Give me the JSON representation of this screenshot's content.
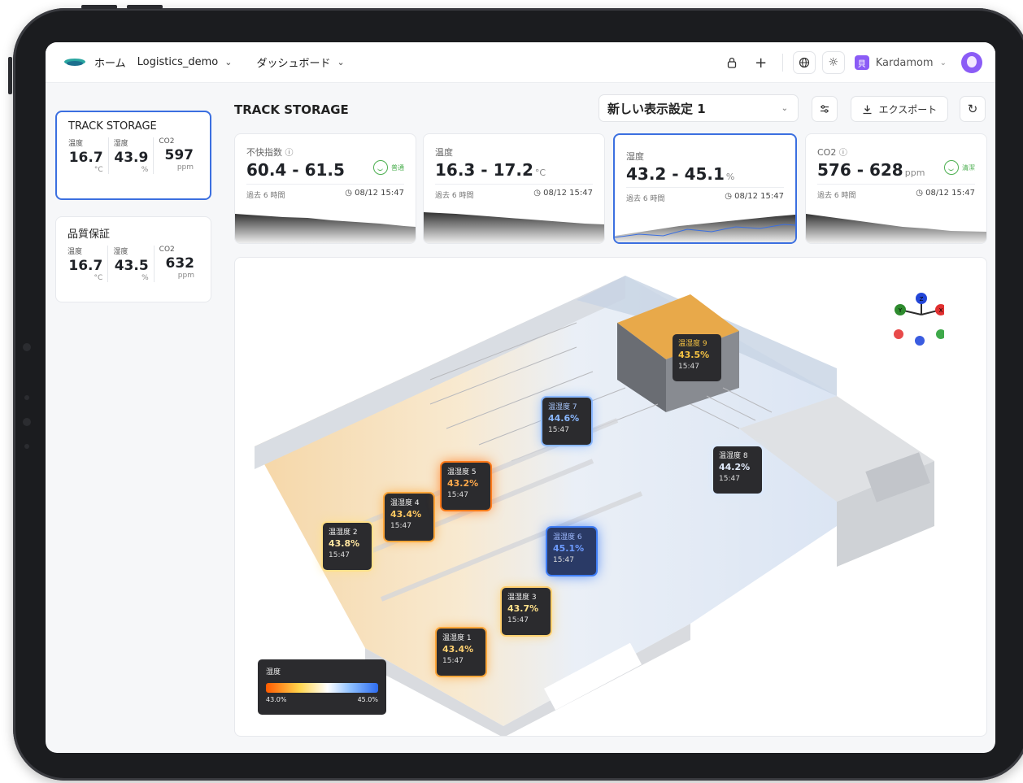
{
  "nav": {
    "home": "ホーム",
    "project": "Logistics_demo",
    "dashboard": "ダッシュボード",
    "user_initial": "貝",
    "user_name": "Kardamom"
  },
  "sidebar": {
    "locations": [
      {
        "name": "TRACK STORAGE",
        "temp_label": "温度",
        "hum_label": "湿度",
        "co2_label": "CO2",
        "temp": "16.7",
        "hum": "43.9",
        "co2": "597",
        "temp_unit": "°C",
        "hum_unit": "%",
        "co2_unit": "ppm"
      },
      {
        "name": "品質保証",
        "temp_label": "温度",
        "hum_label": "湿度",
        "co2_label": "CO2",
        "temp": "16.7",
        "hum": "43.5",
        "co2": "632",
        "temp_unit": "°C",
        "hum_unit": "%",
        "co2_unit": "ppm"
      }
    ]
  },
  "main": {
    "title": "TRACK STORAGE",
    "view_setting": "新しい表示設定 1",
    "export_label": "エクスポート"
  },
  "metrics": [
    {
      "label": "不快指数",
      "value": "60.4 - 61.5",
      "unit": "",
      "status": "普通",
      "period": "過去 6 時間",
      "time": "08/12 15:47"
    },
    {
      "label": "温度",
      "value": "16.3 - 17.2",
      "unit": "°C",
      "status": "",
      "period": "過去 6 時間",
      "time": "08/12 15:47"
    },
    {
      "label": "湿度",
      "value": "43.2 - 45.1",
      "unit": "%",
      "status": "",
      "period": "過去 6 時間",
      "time": "08/12 15:47"
    },
    {
      "label": "CO2",
      "value": "576 - 628",
      "unit": "ppm",
      "status": "清潔",
      "period": "過去 6 時間",
      "time": "08/12 15:47"
    }
  ],
  "sensors": [
    {
      "name": "温湿度 1",
      "value": "43.4%",
      "time": "15:47",
      "color": "#ffa73a"
    },
    {
      "name": "温湿度 2",
      "value": "43.8%",
      "time": "15:47",
      "color": "#ffe08a"
    },
    {
      "name": "温湿度 3",
      "value": "43.7%",
      "time": "15:47",
      "color": "#ffd070"
    },
    {
      "name": "温湿度 4",
      "value": "43.4%",
      "time": "15:47",
      "color": "#ffa73a"
    },
    {
      "name": "温湿度 5",
      "value": "43.2%",
      "time": "15:47",
      "color": "#ff7a1a"
    },
    {
      "name": "温湿度 6",
      "value": "45.1%",
      "time": "15:47",
      "color": "#3f7df5"
    },
    {
      "name": "温湿度 7",
      "value": "44.6%",
      "time": "15:47",
      "color": "#8ab8ff"
    },
    {
      "name": "温湿度 8",
      "value": "44.2%",
      "time": "15:47",
      "color": "#dbe9ff"
    },
    {
      "name": "温湿度 9",
      "value": "43.5%",
      "time": "15:47",
      "color": "#f5c242"
    }
  ],
  "legend": {
    "title": "湿度",
    "min": "43.0%",
    "max": "45.0%"
  },
  "colors": {
    "accent": "#3b6fe0",
    "ok": "#4caf50"
  }
}
